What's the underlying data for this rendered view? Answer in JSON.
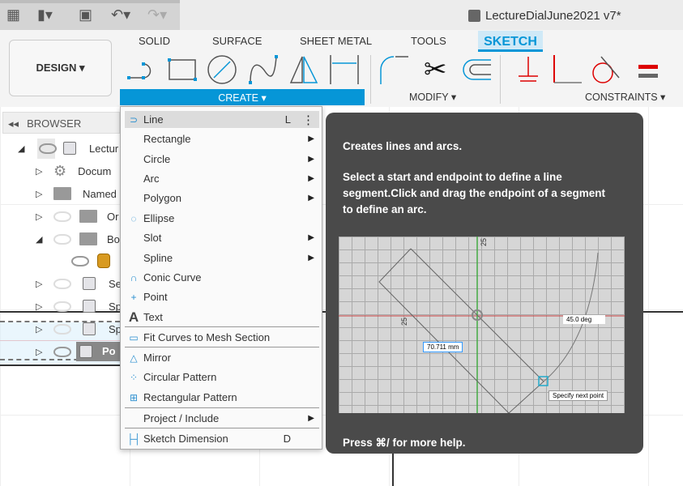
{
  "topbar": {
    "icons": [
      "grid-apps-icon",
      "file-icon",
      "save-icon",
      "undo-icon",
      "redo-icon"
    ],
    "title": "LectureDialJune2021 v7*"
  },
  "ribbon": {
    "workspace": "DESIGN ▾",
    "tabs": [
      "SOLID",
      "SURFACE",
      "SHEET METAL",
      "TOOLS",
      "SKETCH"
    ],
    "active_tab": "SKETCH",
    "groups": {
      "create": "CREATE ▾",
      "modify": "MODIFY ▾",
      "constraints": "CONSTRAINTS ▾"
    },
    "accent": "#0696d7"
  },
  "browser": {
    "header": "BROWSER",
    "rows": [
      {
        "label": "Lectur",
        "expanded": true,
        "visible": true
      },
      {
        "label": "Docum",
        "expanded": false
      },
      {
        "label": "Named",
        "expanded": false
      },
      {
        "label": "Or",
        "expanded": false,
        "visible": false
      },
      {
        "label": "Bo",
        "expanded": true,
        "visible": false
      },
      {
        "label": "",
        "visible": true
      },
      {
        "label": "Se",
        "expanded": false,
        "visible": false
      },
      {
        "label": "Sp",
        "expanded": false,
        "visible": false
      },
      {
        "label": "Sp",
        "expanded": false,
        "visible": false
      },
      {
        "label": "Po",
        "expanded": false,
        "visible": true
      }
    ]
  },
  "create_menu": {
    "items": [
      {
        "label": "Line",
        "shortcut": "L",
        "icon": "line-icon",
        "highlighted": true
      },
      {
        "label": "Rectangle",
        "submenu": true
      },
      {
        "label": "Circle",
        "submenu": true
      },
      {
        "label": "Arc",
        "submenu": true
      },
      {
        "label": "Polygon",
        "submenu": true
      },
      {
        "label": "Ellipse",
        "icon": "ellipse-icon"
      },
      {
        "label": "Slot",
        "submenu": true
      },
      {
        "label": "Spline",
        "submenu": true
      },
      {
        "label": "Conic Curve",
        "icon": "conic-curve-icon"
      },
      {
        "label": "Point",
        "icon": "point-icon"
      },
      {
        "label": "Text",
        "icon": "text-icon"
      },
      {
        "label": "Fit Curves to Mesh Section",
        "icon": "fit-curves-icon"
      },
      {
        "label": "Mirror",
        "icon": "mirror-icon"
      },
      {
        "label": "Circular Pattern",
        "icon": "circular-pattern-icon"
      },
      {
        "label": "Rectangular Pattern",
        "icon": "rectangular-pattern-icon"
      },
      {
        "label": "Project / Include",
        "submenu": true
      },
      {
        "label": "Sketch Dimension",
        "shortcut": "D",
        "icon": "sketch-dimension-icon"
      }
    ]
  },
  "tooltip": {
    "title": "Creates lines and arcs.",
    "body": "Select a start and endpoint to define a line segment.Click and drag the endpoint of a segment to define an arc.",
    "footer": "Press ⌘/ for more help.",
    "image": {
      "length": "70.711 mm",
      "angle": "45.0 deg",
      "prompt": "Specify next point",
      "axis_label_top": "25",
      "axis_label_left": "25"
    }
  }
}
